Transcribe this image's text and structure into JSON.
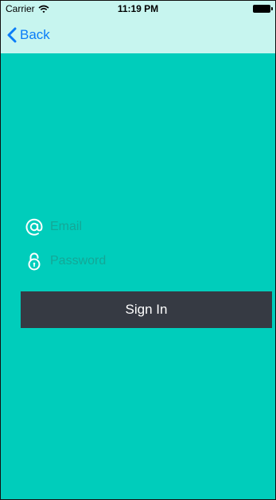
{
  "status_bar": {
    "carrier": "Carrier",
    "time": "11:19 PM",
    "wifi_icon": "wifi-icon",
    "battery_icon": "battery-icon"
  },
  "nav": {
    "back_label": "Back",
    "back_icon": "chevron-left-icon"
  },
  "form": {
    "email": {
      "icon": "at-sign-icon",
      "placeholder": "Email",
      "value": ""
    },
    "password": {
      "icon": "lock-icon",
      "placeholder": "Password",
      "value": ""
    },
    "signin_label": "Sign In"
  },
  "colors": {
    "background": "#00cdbb",
    "bar": "#c7f5ef",
    "button": "#363a43",
    "accent": "#0a7df8"
  }
}
